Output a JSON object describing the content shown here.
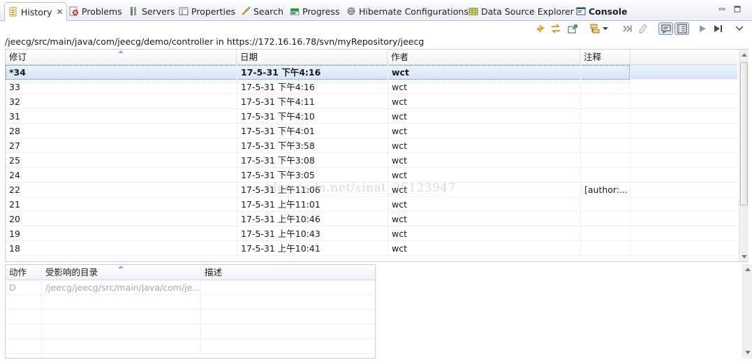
{
  "tabs": [
    {
      "label": "History",
      "icon": "history-icon",
      "active": true
    },
    {
      "label": "Problems",
      "icon": "problems-icon"
    },
    {
      "label": "Servers",
      "icon": "servers-icon"
    },
    {
      "label": "Properties",
      "icon": "properties-icon"
    },
    {
      "label": "Search",
      "icon": "search-icon"
    },
    {
      "label": "Progress",
      "icon": "progress-icon"
    },
    {
      "label": "Hibernate Configurations",
      "icon": "hibernate-icon"
    },
    {
      "label": "Data Source Explorer",
      "icon": "data-source-icon"
    },
    {
      "label": "Console",
      "icon": "console-icon"
    }
  ],
  "path": "/jeecg/src/main/java/com/jeecg/demo/controller in https://172.16.16.78/svn/myRepository/jeecg",
  "history_table": {
    "columns": [
      "修订",
      "日期",
      "作者",
      "注释"
    ],
    "rows": [
      {
        "rev": "*34",
        "date": "17-5-31 下午4:16",
        "author": "wct",
        "comment": "",
        "selected": true
      },
      {
        "rev": "33",
        "date": "17-5-31 下午4:16",
        "author": "wct",
        "comment": ""
      },
      {
        "rev": "32",
        "date": "17-5-31 下午4:11",
        "author": "wct",
        "comment": ""
      },
      {
        "rev": "31",
        "date": "17-5-31 下午4:10",
        "author": "wct",
        "comment": ""
      },
      {
        "rev": "28",
        "date": "17-5-31 下午4:01",
        "author": "wct",
        "comment": ""
      },
      {
        "rev": "27",
        "date": "17-5-31 下午3:58",
        "author": "wct",
        "comment": ""
      },
      {
        "rev": "25",
        "date": "17-5-31 下午3:08",
        "author": "wct",
        "comment": ""
      },
      {
        "rev": "24",
        "date": "17-5-31 下午3:05",
        "author": "wct",
        "comment": ""
      },
      {
        "rev": "22",
        "date": "17-5-31 上午11:06",
        "author": "wct",
        "comment": "[author:..."
      },
      {
        "rev": "21",
        "date": "17-5-31 上午11:01",
        "author": "wct",
        "comment": ""
      },
      {
        "rev": "20",
        "date": "17-5-31 上午10:46",
        "author": "wct",
        "comment": ""
      },
      {
        "rev": "19",
        "date": "17-5-31 上午10:43",
        "author": "wct",
        "comment": ""
      },
      {
        "rev": "18",
        "date": "17-5-31 上午10:41",
        "author": "wct",
        "comment": ""
      }
    ]
  },
  "watermark": "blog.csdn.net/sinat_25123947",
  "paths_table": {
    "columns": [
      "动作",
      "受影响的目录",
      "描述"
    ],
    "rows": [
      {
        "action": "D",
        "path": "/jeecg/jeecg/src/main/java/com/je...",
        "desc": ""
      }
    ]
  },
  "colors": {
    "accent": "#8aa6cf",
    "selection": "#d6e6f9"
  }
}
